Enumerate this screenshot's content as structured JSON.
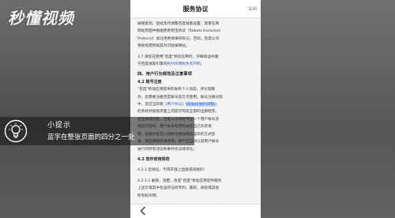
{
  "watermark": {
    "brand": "秒懂视频"
  },
  "phone": {
    "header": {
      "title": "服务协议",
      "close_label": "关闭"
    },
    "content": {
      "lines": [
        "被搜索到，后续及时调整百度搜索设置，或者在网",
        "网站页面中根据拒绝爬虫协议（Robots Exclusion",
        "Protocol）加注拒绝收录的标记，否则，百度公司",
        "将依照惯例视其为可收录网站。"
      ],
      "para_3_7": "3.7 请您在使用\"百度\"移动应用时，仔细阅读并遵",
      "para_3_7b_prefix": "守百度搜索引擎的",
      "para_3_7b_link": "权利声明和免责声明",
      "para_3_7b_suffix": "。",
      "section_title": "四、用户行为规范及注意事项",
      "sub_4_1": "4.1 账号注册",
      "body_lines": [
        "\"百度\"移动应用提供的发布个人动态、评论等服",
        "务，您需要注册百度账号后方可使用。账号注册过程"
      ],
      "line_link_prefix": "中，您应当同意",
      "line_link_1": "《用户协议》",
      "line_link_2": "《隐私权保护声明》",
      "more_lines": [
        "的条款并按照页面上的提示完成全部的注册程序。",
        "您注册成功后，百度公司将给予您一个用户帐号及",
        "相应的密码，用户帐号和密码由您自己负责保",
        "管。您要对您在以前帐号登陆或验证码的方式登",
        "录，请您谨慎登录使用，用户应当对以其用户帐号",
        "进行的所有活动和事件负法律责任。"
      ],
      "sub_4_2": "4.2 软件使用规范",
      "item_4_2_1": "4.2.1 您保证，不得开放上直接或间接的：",
      "item_4_2_1_1_lines": [
        "4.2.1.1 删除、隐匿、改变\"百度\"移动应用软件服务",
        "上显示或其中包含的任何专利、版权、商标或其他",
        "所有权声明；"
      ],
      "item_4_2_1_2": "4.2.1.2 以任何方式干扰或企图干扰\"百度\"移动应用"
    }
  },
  "tip": {
    "title": "小提示",
    "text": "蓝字在整张页面的四分之一处"
  },
  "colors": {
    "link": "#2a62c9",
    "highlight": "#bcd6f5",
    "tip_bg": "rgba(20,20,20,0.55)"
  },
  "icons": {
    "tip": "lightbulb-icon",
    "back": "chevron-left-icon"
  }
}
